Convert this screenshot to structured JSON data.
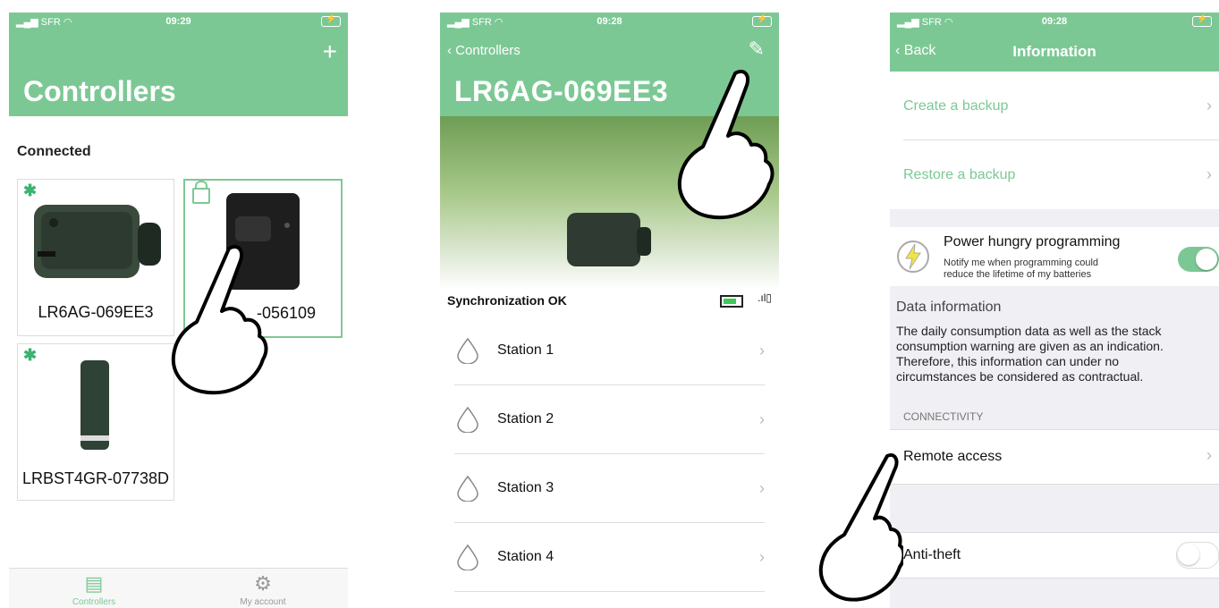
{
  "phone1": {
    "status": {
      "carrier": "SFR",
      "time": "09:29"
    },
    "header": {
      "title": "Controllers",
      "add_label": "+"
    },
    "section_title": "Connected",
    "devices": [
      {
        "name": "LR6AG-069EE3"
      },
      {
        "name": "-056109"
      },
      {
        "name": "LRBST4GR-07738D"
      }
    ],
    "tabs": [
      {
        "label": "Controllers"
      },
      {
        "label": "My account"
      }
    ]
  },
  "phone2": {
    "status": {
      "carrier": "SFR",
      "time": "09:28"
    },
    "back_label": "Controllers",
    "title": "LR6AG-069EE3",
    "sync": "Synchronization OK",
    "stations": [
      {
        "label": "Station 1"
      },
      {
        "label": "Station 2"
      },
      {
        "label": "Station 3"
      },
      {
        "label": "Station 4"
      }
    ]
  },
  "phone3": {
    "status": {
      "carrier": "SFR",
      "time": "09:28"
    },
    "back_label": "Back",
    "title": "Information",
    "create_backup": "Create a backup",
    "restore_backup": "Restore a backup",
    "power": {
      "title": "Power hungry programming",
      "desc_line1": "Notify me when programming could",
      "desc_line2": "reduce the lifetime of my batteries",
      "enabled": true
    },
    "data_info": {
      "title": "Data information",
      "body": "The daily consumption data as well as the stack consumption warning are given as an indication. Therefore, this information can under no circumstances be considered as contractual."
    },
    "connectivity_header": "CONNECTIVITY",
    "remote_access": "Remote access",
    "anti_theft": {
      "label": "Anti-theft",
      "enabled": false
    }
  },
  "colors": {
    "accent": "#7cc895",
    "accent_text": "#7cc895",
    "battery_green": "#3cc95a"
  }
}
